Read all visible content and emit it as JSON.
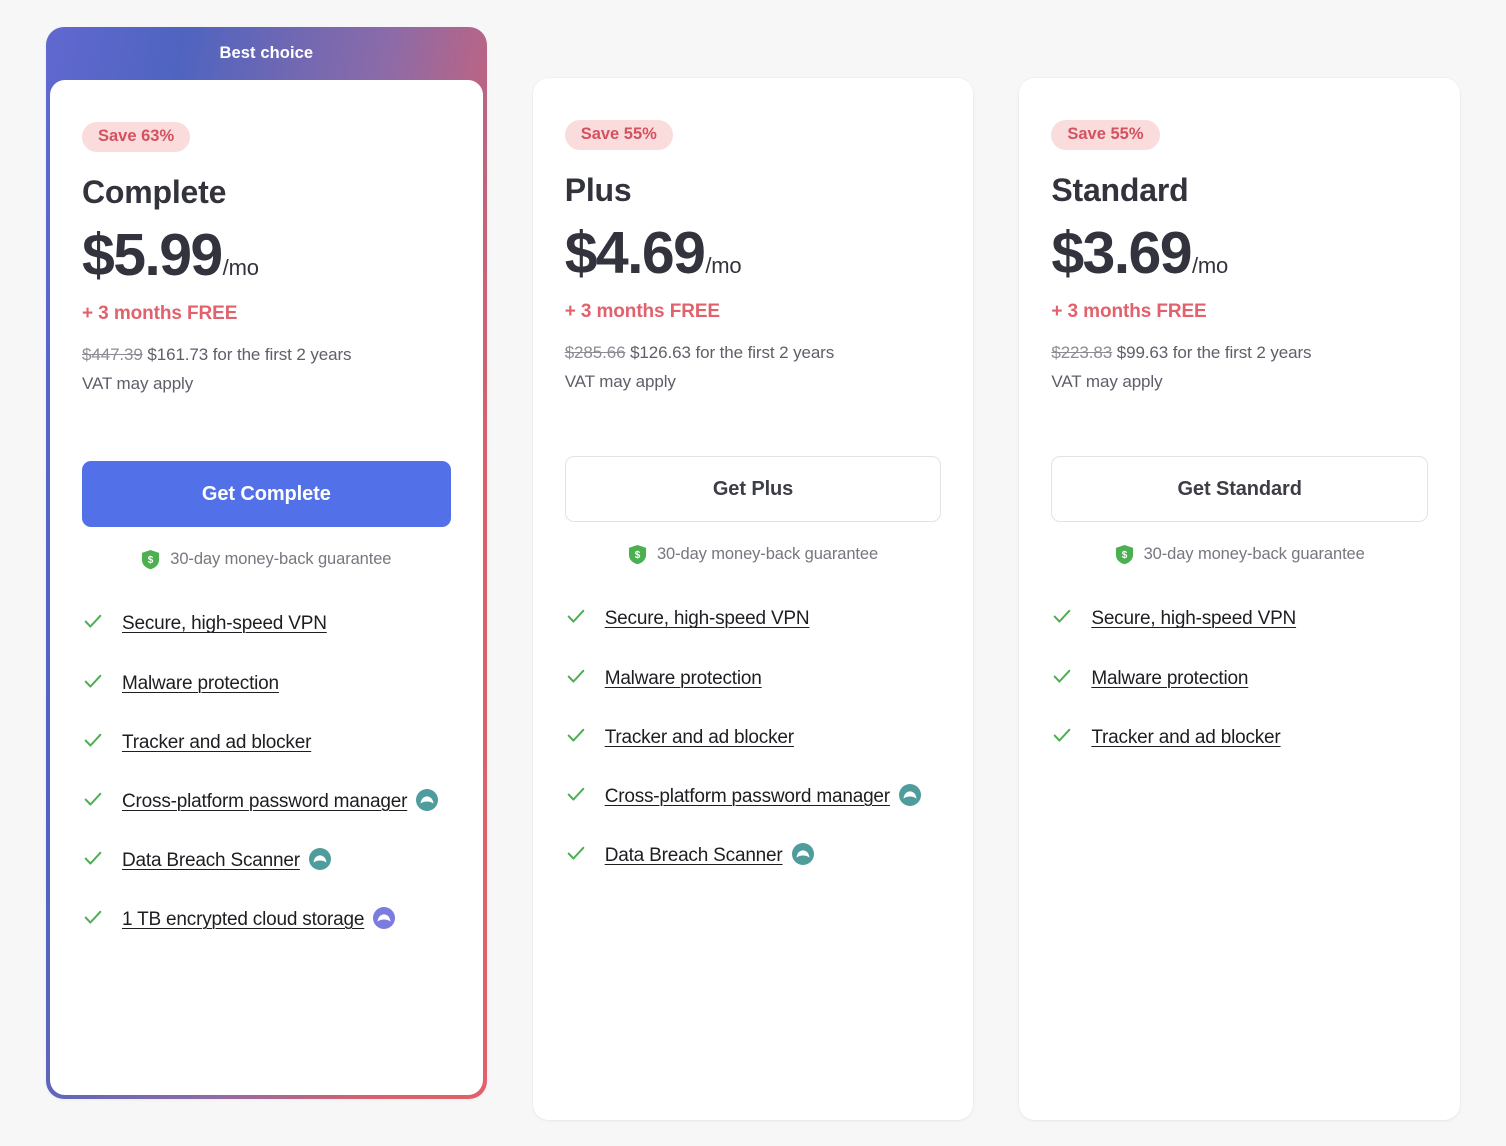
{
  "page": {
    "background_color": "#f7f7f7",
    "accent_blue": "#5271e8",
    "accent_red": "#e1616c",
    "badge_bg": "#fadcdd",
    "badge_text_color": "#d4525f",
    "check_color": "#4caf50"
  },
  "plans": [
    {
      "id": "complete",
      "featured": true,
      "banner_label": "Best choice",
      "save_badge": "Save 63%",
      "name": "Complete",
      "price": "$5.99",
      "price_period": "/mo",
      "free_months": "+ 3 months FREE",
      "old_total": "$447.39",
      "new_total": "$161.73",
      "total_suffix": "for the first 2 years",
      "vat_note": "VAT may apply",
      "cta_label": "Get Complete",
      "guarantee": "30-day money-back guarantee",
      "features": [
        {
          "label": "Secure, high-speed VPN",
          "badge": ""
        },
        {
          "label": "Malware protection",
          "badge": ""
        },
        {
          "label": "Tracker and ad blocker",
          "badge": ""
        },
        {
          "label": "Cross-platform password manager",
          "badge": "teal"
        },
        {
          "label": "Data Breach Scanner",
          "badge": "teal"
        },
        {
          "label": "1 TB encrypted cloud storage",
          "badge": "purple"
        }
      ]
    },
    {
      "id": "plus",
      "featured": false,
      "banner_label": "",
      "save_badge": "Save 55%",
      "name": "Plus",
      "price": "$4.69",
      "price_period": "/mo",
      "free_months": "+ 3 months FREE",
      "old_total": "$285.66",
      "new_total": "$126.63",
      "total_suffix": "for the first 2 years",
      "vat_note": "VAT may apply",
      "cta_label": "Get Plus",
      "guarantee": "30-day money-back guarantee",
      "features": [
        {
          "label": "Secure, high-speed VPN",
          "badge": ""
        },
        {
          "label": "Malware protection",
          "badge": ""
        },
        {
          "label": "Tracker and ad blocker",
          "badge": ""
        },
        {
          "label": "Cross-platform password manager",
          "badge": "teal"
        },
        {
          "label": "Data Breach Scanner",
          "badge": "teal"
        }
      ]
    },
    {
      "id": "standard",
      "featured": false,
      "banner_label": "",
      "save_badge": "Save 55%",
      "name": "Standard",
      "price": "$3.69",
      "price_period": "/mo",
      "free_months": "+ 3 months FREE",
      "old_total": "$223.83",
      "new_total": "$99.63",
      "total_suffix": "for the first 2 years",
      "vat_note": "VAT may apply",
      "cta_label": "Get Standard",
      "guarantee": "30-day money-back guarantee",
      "features": [
        {
          "label": "Secure, high-speed VPN",
          "badge": ""
        },
        {
          "label": "Malware protection",
          "badge": ""
        },
        {
          "label": "Tracker and ad blocker",
          "badge": ""
        }
      ]
    }
  ]
}
